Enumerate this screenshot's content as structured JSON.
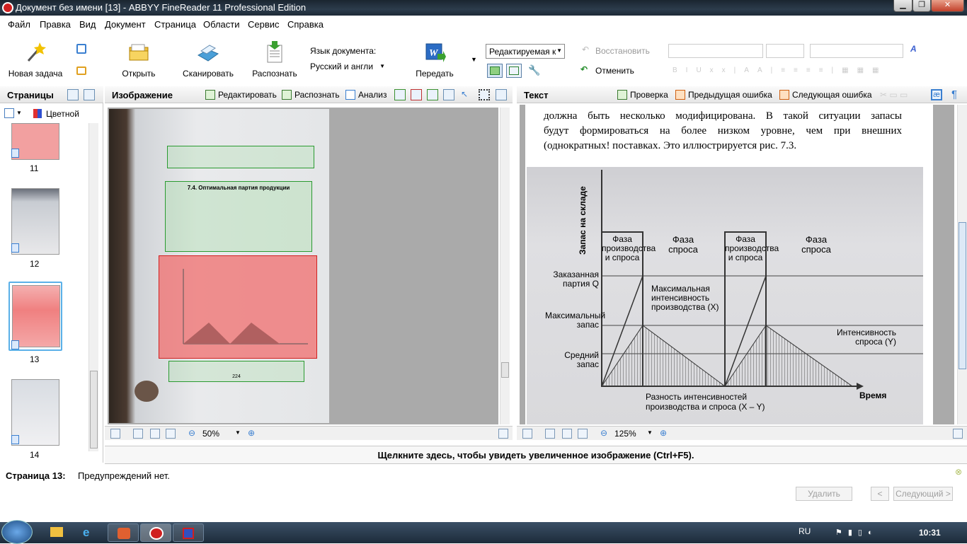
{
  "window": {
    "title": "Документ без имени [13] - ABBYY FineReader 11 Professional Edition"
  },
  "menu": [
    "Файл",
    "Правка",
    "Вид",
    "Документ",
    "Страница",
    "Области",
    "Сервис",
    "Справка"
  ],
  "toolbar": {
    "new_task": "Новая задача",
    "open": "Открыть",
    "scan": "Сканировать",
    "recognize": "Распознать",
    "doc_lang_label": "Язык документа:",
    "doc_lang_value": "Русский и англи",
    "send": "Передать",
    "format_mode": "Редактируемая к",
    "restore": "Восстановить",
    "undo": "Отменить"
  },
  "pages_panel": {
    "title": "Страницы",
    "color_mode": "Цветной",
    "thumbnails": [
      {
        "num": "11"
      },
      {
        "num": "12"
      },
      {
        "num": "13",
        "selected": true
      },
      {
        "num": "14"
      }
    ]
  },
  "image_panel": {
    "title": "Изображение",
    "edit": "Редактировать",
    "recognize": "Распознать",
    "analyze": "Анализ",
    "zoom": "50%",
    "page_text": {
      "heading": "7.4. Оптимальная партия продукции",
      "page_number": "224"
    }
  },
  "text_panel": {
    "title": "Текст",
    "check": "Проверка",
    "prev_error": "Предыдущая ошибка",
    "next_error": "Следующая ошибка",
    "zoom": "125%",
    "paragraph": [
      "должна быть несколько модифицирована. В такой ситуации запасы",
      "будут формироваться на более низком уровне, чем при внешних",
      "(однократных! поставках. Это иллюстрируется рис. 7.3."
    ],
    "figure": {
      "y_axis": "Запас на складе",
      "x_axis": "Время",
      "phase1": "Фаза производства и спроса",
      "phase2": "Фаза спроса",
      "phase3": "Фаза производства и спроса",
      "phase4": "Фаза спроса",
      "label_ordered": "Заказанная партия Q",
      "label_max": "Максимальный запас",
      "label_avg": "Средний запас",
      "label_max_intensity": "Максимальная интенсивность производства (X)",
      "label_demand": "Интенсивность спроса (Y)",
      "label_diff": "Разность интенсивностей производства и спроса (X – Y)"
    }
  },
  "zoom_hint": "Щелкните здесь, чтобы увидеть увеличенное изображение (Ctrl+F5).",
  "status": {
    "page_label": "Страница 13:",
    "message": "Предупреждений нет.",
    "delete": "Удалить",
    "prev": "<",
    "next": "Следующий >"
  },
  "taskbar": {
    "lang": "RU",
    "time": "10:31"
  }
}
